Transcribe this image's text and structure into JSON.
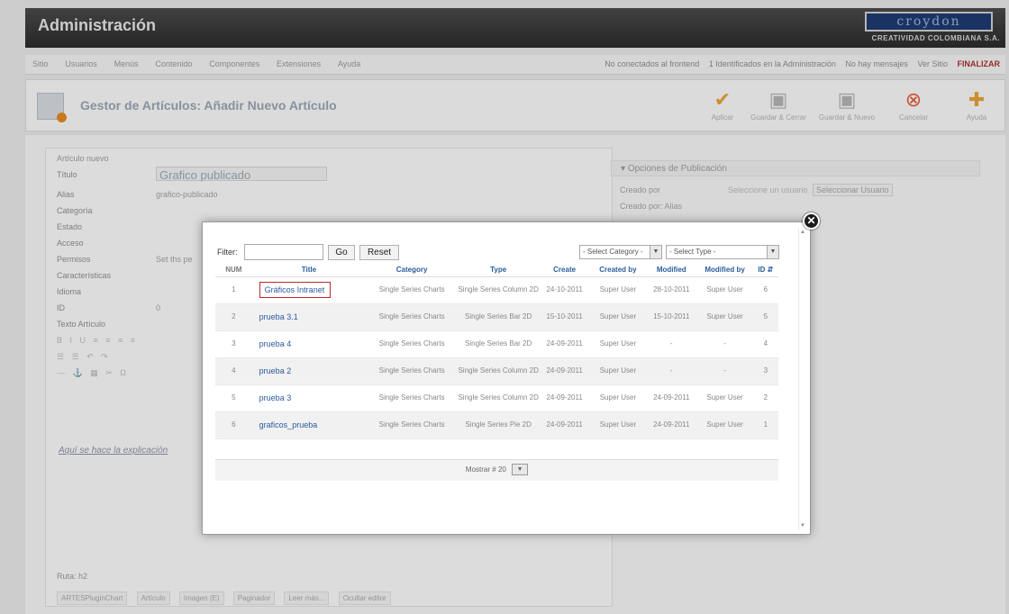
{
  "app": {
    "title": "Administración"
  },
  "logo": {
    "name": "croydon",
    "subtitle": "CREATIVIDAD COLOMBIANA S.A."
  },
  "menu": {
    "items": [
      "Sitio",
      "Usuarios",
      "Menús",
      "Contenido",
      "Componentes",
      "Extensiones",
      "Ayuda"
    ],
    "status": [
      "No conectados al frontend",
      "1 Identificados en la Administración",
      "No hay mensajes",
      "Ver Sitio"
    ],
    "logout": "FINALIZAR"
  },
  "toolbar": {
    "page_title": "Gestor de Artículos: Añadir Nuevo Artículo",
    "buttons": [
      {
        "label": "Aplicar",
        "icon": "check-icon",
        "color": "#e8a33a"
      },
      {
        "label": "Guardar & Cerrar",
        "icon": "save-icon",
        "color": "#b4b4b4"
      },
      {
        "label": "Guardar & Nuevo",
        "icon": "save-new-icon",
        "color": "#b4b4b4"
      },
      {
        "label": "Cancelar",
        "icon": "cancel-icon",
        "color": "#e45a3a"
      },
      {
        "label": "Ayuda",
        "icon": "help-icon",
        "color": "#e8a33a"
      }
    ]
  },
  "form": {
    "legend": "Artículo nuevo",
    "fields": [
      {
        "label": "Título",
        "value": "Grafico publicado"
      },
      {
        "label": "Alias",
        "value": "grafico-publicado"
      },
      {
        "label": "Categoría",
        "value": ""
      },
      {
        "label": "Estado",
        "value": ""
      },
      {
        "label": "Acceso",
        "value": ""
      },
      {
        "label": "Permisos",
        "value": "Set ths pe"
      },
      {
        "label": "Características",
        "value": ""
      },
      {
        "label": "Idioma",
        "value": ""
      },
      {
        "label": "ID",
        "value": "0"
      },
      {
        "label": "Texto Artículo",
        "value": ""
      }
    ],
    "editor_text": "Aquí se hace la explicación",
    "path_label": "Ruta: h2",
    "editor_buttons": [
      "ARTESPluginChart",
      "Artículo",
      "Imagen (E)",
      "Paginador",
      "Leer más...",
      "Ocultar editor"
    ]
  },
  "publish": {
    "heading": "Opciones de Publicación",
    "created_by": "Creado por",
    "created_by_alias": "Creado por: Alias",
    "select_user_button": "Seleccionar Usuario",
    "select_user_placeholder": "Seleccione un usuario"
  },
  "modal": {
    "close_symbol": "✕",
    "filter_label": "Filter:",
    "filter_value": "",
    "go_label": "Go",
    "reset_label": "Reset",
    "category_select": "- Select Category -",
    "type_select": "- Select Type -",
    "columns": [
      "NUM",
      "Title",
      "Category",
      "Type",
      "Create",
      "Created by",
      "Modified",
      "Modified by",
      "ID"
    ],
    "rows": [
      {
        "num": "1",
        "title": "Gráficos Intranet",
        "category": "Single Series Charts",
        "type": "Single Series Column 2D",
        "create": "24-10-2011",
        "created_by": "Super User",
        "modified": "28-10-2011",
        "modified_by": "Super User",
        "id": "6"
      },
      {
        "num": "2",
        "title": "prueba 3.1",
        "category": "Single Series Charts",
        "type": "Single Series Bar 2D",
        "create": "15-10-2011",
        "created_by": "Super User",
        "modified": "15-10-2011",
        "modified_by": "Super User",
        "id": "5"
      },
      {
        "num": "3",
        "title": "prueba 4",
        "category": "Single Series Charts",
        "type": "Single Series Bar 2D",
        "create": "24-09-2011",
        "created_by": "Super User",
        "modified": "-",
        "modified_by": "-",
        "id": "4"
      },
      {
        "num": "4",
        "title": "prueba 2",
        "category": "Single Series Charts",
        "type": "Single Series Column 2D",
        "create": "24-09-2011",
        "created_by": "Super User",
        "modified": "-",
        "modified_by": "-",
        "id": "3"
      },
      {
        "num": "5",
        "title": "prueba 3",
        "category": "Single Series Charts",
        "type": "Single Series Column 2D",
        "create": "24-09-2011",
        "created_by": "Super User",
        "modified": "24-09-2011",
        "modified_by": "Super User",
        "id": "2"
      },
      {
        "num": "6",
        "title": "graficos_prueba",
        "category": "Single Series Charts",
        "type": "Single Series Pie 2D",
        "create": "24-09-2011",
        "created_by": "Super User",
        "modified": "24-09-2011",
        "modified_by": "Super User",
        "id": "1"
      }
    ],
    "highlighted_row": 0,
    "pager_label": "Mostrar #",
    "pager_value": "20"
  }
}
